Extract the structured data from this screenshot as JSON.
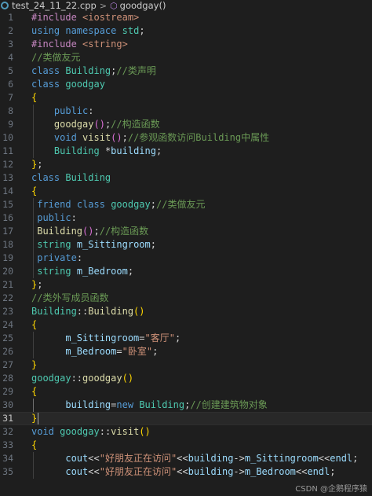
{
  "breadcrumb": {
    "file_name": "test_24_11_22.cpp",
    "separator": ">",
    "symbol_name": "goodgay()",
    "file_icon": "cpp-file-icon",
    "symbol_icon": "method-icon"
  },
  "editor": {
    "current_line": 31,
    "lines": [
      {
        "n": 1,
        "tokens": [
          [
            "pp",
            "#include"
          ],
          [
            "pl",
            " "
          ],
          [
            "inc",
            "<iostream>"
          ]
        ]
      },
      {
        "n": 2,
        "tokens": [
          [
            "kw",
            "using"
          ],
          [
            "pl",
            " "
          ],
          [
            "kw",
            "namespace"
          ],
          [
            "pl",
            " "
          ],
          [
            "ns",
            "std"
          ],
          [
            "pl",
            ";"
          ]
        ]
      },
      {
        "n": 3,
        "tokens": [
          [
            "pp",
            "#include"
          ],
          [
            "pl",
            " "
          ],
          [
            "inc",
            "<string>"
          ]
        ]
      },
      {
        "n": 4,
        "tokens": [
          [
            "cm",
            "//类做友元"
          ]
        ]
      },
      {
        "n": 5,
        "tokens": [
          [
            "kw",
            "class"
          ],
          [
            "pl",
            " "
          ],
          [
            "ty",
            "Building"
          ],
          [
            "pl",
            ";"
          ],
          [
            "cm",
            "//类声明"
          ]
        ]
      },
      {
        "n": 6,
        "tokens": [
          [
            "kw",
            "class"
          ],
          [
            "pl",
            " "
          ],
          [
            "ty",
            "goodgay"
          ]
        ]
      },
      {
        "n": 7,
        "tokens": [
          [
            "br1",
            "{"
          ]
        ]
      },
      {
        "n": 8,
        "tokens": [
          [
            "pl",
            "    "
          ],
          [
            "kw",
            "public"
          ],
          [
            "pl",
            ":"
          ]
        ]
      },
      {
        "n": 9,
        "tokens": [
          [
            "pl",
            "    "
          ],
          [
            "fn",
            "goodgay"
          ],
          [
            "br2",
            "()"
          ],
          [
            "pl",
            ";"
          ],
          [
            "cm",
            "//构造函数"
          ]
        ]
      },
      {
        "n": 10,
        "tokens": [
          [
            "pl",
            "    "
          ],
          [
            "kw",
            "void"
          ],
          [
            "pl",
            " "
          ],
          [
            "fn",
            "visit"
          ],
          [
            "br2",
            "()"
          ],
          [
            "pl",
            ";"
          ],
          [
            "cm",
            "//参观函数访问Building中属性"
          ]
        ]
      },
      {
        "n": 11,
        "tokens": [
          [
            "pl",
            "    "
          ],
          [
            "ty",
            "Building"
          ],
          [
            "pl",
            " "
          ],
          [
            "op",
            "*"
          ],
          [
            "vr",
            "building"
          ],
          [
            "pl",
            ";"
          ]
        ]
      },
      {
        "n": 12,
        "tokens": [
          [
            "br1",
            "}"
          ],
          [
            "pl",
            ";"
          ]
        ]
      },
      {
        "n": 13,
        "tokens": [
          [
            "kw",
            "class"
          ],
          [
            "pl",
            " "
          ],
          [
            "ty",
            "Building"
          ]
        ]
      },
      {
        "n": 14,
        "tokens": [
          [
            "br1",
            "{"
          ]
        ]
      },
      {
        "n": 15,
        "tokens": [
          [
            "pl",
            " "
          ],
          [
            "kw",
            "friend"
          ],
          [
            "pl",
            " "
          ],
          [
            "kw",
            "class"
          ],
          [
            "pl",
            " "
          ],
          [
            "ty",
            "goodgay"
          ],
          [
            "pl",
            ";"
          ],
          [
            "cm",
            "//类做友元"
          ]
        ]
      },
      {
        "n": 16,
        "tokens": [
          [
            "pl",
            " "
          ],
          [
            "kw",
            "public"
          ],
          [
            "pl",
            ":"
          ]
        ]
      },
      {
        "n": 17,
        "tokens": [
          [
            "pl",
            " "
          ],
          [
            "fn",
            "Building"
          ],
          [
            "br2",
            "()"
          ],
          [
            "pl",
            ";"
          ],
          [
            "cm",
            "//构造函数"
          ]
        ]
      },
      {
        "n": 18,
        "tokens": [
          [
            "pl",
            " "
          ],
          [
            "ty",
            "string"
          ],
          [
            "pl",
            " "
          ],
          [
            "vr",
            "m_Sittingroom"
          ],
          [
            "pl",
            ";"
          ]
        ]
      },
      {
        "n": 19,
        "tokens": [
          [
            "pl",
            " "
          ],
          [
            "kw",
            "private"
          ],
          [
            "pl",
            ":"
          ]
        ]
      },
      {
        "n": 20,
        "tokens": [
          [
            "pl",
            " "
          ],
          [
            "ty",
            "string"
          ],
          [
            "pl",
            " "
          ],
          [
            "vr",
            "m_Bedroom"
          ],
          [
            "pl",
            ";"
          ]
        ]
      },
      {
        "n": 21,
        "tokens": [
          [
            "br1",
            "}"
          ],
          [
            "pl",
            ";"
          ]
        ]
      },
      {
        "n": 22,
        "tokens": [
          [
            "cm",
            "//类外写成员函数"
          ]
        ]
      },
      {
        "n": 23,
        "tokens": [
          [
            "ty",
            "Building"
          ],
          [
            "pl",
            "::"
          ],
          [
            "fn",
            "Building"
          ],
          [
            "br1",
            "()"
          ]
        ]
      },
      {
        "n": 24,
        "tokens": [
          [
            "br1",
            "{"
          ]
        ]
      },
      {
        "n": 25,
        "tokens": [
          [
            "pl",
            "      "
          ],
          [
            "vr",
            "m_Sittingroom"
          ],
          [
            "op",
            "="
          ],
          [
            "st",
            "\"客厅\""
          ],
          [
            "pl",
            ";"
          ]
        ]
      },
      {
        "n": 26,
        "tokens": [
          [
            "pl",
            "      "
          ],
          [
            "vr",
            "m_Bedroom"
          ],
          [
            "op",
            "="
          ],
          [
            "st",
            "\"卧室\""
          ],
          [
            "pl",
            ";"
          ]
        ]
      },
      {
        "n": 27,
        "tokens": [
          [
            "br1",
            "}"
          ]
        ]
      },
      {
        "n": 28,
        "tokens": [
          [
            "ty",
            "goodgay"
          ],
          [
            "pl",
            "::"
          ],
          [
            "fn",
            "goodgay"
          ],
          [
            "br1",
            "()"
          ]
        ]
      },
      {
        "n": 29,
        "tokens": [
          [
            "br1",
            "{"
          ]
        ]
      },
      {
        "n": 30,
        "tokens": [
          [
            "pl",
            "      "
          ],
          [
            "vr",
            "building"
          ],
          [
            "op",
            "="
          ],
          [
            "kw",
            "new"
          ],
          [
            "pl",
            " "
          ],
          [
            "ty",
            "Building"
          ],
          [
            "pl",
            ";"
          ],
          [
            "cm",
            "//创建建筑物对象"
          ]
        ]
      },
      {
        "n": 31,
        "tokens": [
          [
            "br1",
            "}"
          ]
        ]
      },
      {
        "n": 32,
        "tokens": [
          [
            "kw",
            "void"
          ],
          [
            "pl",
            " "
          ],
          [
            "ty",
            "goodgay"
          ],
          [
            "pl",
            "::"
          ],
          [
            "fn",
            "visit"
          ],
          [
            "br1",
            "()"
          ]
        ]
      },
      {
        "n": 33,
        "tokens": [
          [
            "br1",
            "{"
          ]
        ]
      },
      {
        "n": 34,
        "tokens": [
          [
            "pl",
            "      "
          ],
          [
            "vr",
            "cout"
          ],
          [
            "op",
            "<<"
          ],
          [
            "st",
            "\"好朋友正在访问\""
          ],
          [
            "op",
            "<<"
          ],
          [
            "vr",
            "building"
          ],
          [
            "op",
            "->"
          ],
          [
            "vr",
            "m_Sittingroom"
          ],
          [
            "op",
            "<<"
          ],
          [
            "vr",
            "endl"
          ],
          [
            "pl",
            ";"
          ]
        ]
      },
      {
        "n": 35,
        "tokens": [
          [
            "pl",
            "      "
          ],
          [
            "vr",
            "cout"
          ],
          [
            "op",
            "<<"
          ],
          [
            "st",
            "\"好朋友正在访问\""
          ],
          [
            "op",
            "<<"
          ],
          [
            "vr",
            "building"
          ],
          [
            "op",
            "->"
          ],
          [
            "vr",
            "m_Bedroom"
          ],
          [
            "op",
            "<<"
          ],
          [
            "vr",
            "endl"
          ],
          [
            "pl",
            ";"
          ]
        ]
      }
    ]
  },
  "watermark": "CSDN @企鹅程序猿"
}
